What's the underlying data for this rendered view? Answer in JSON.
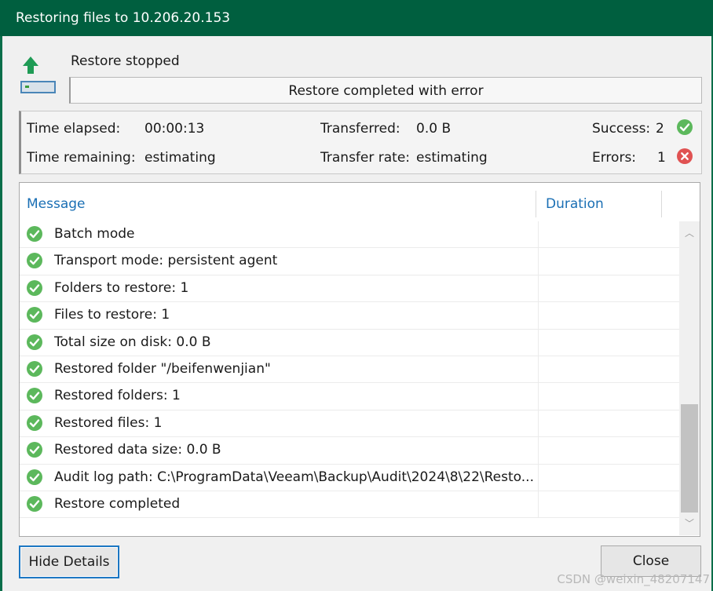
{
  "window": {
    "title": "Restoring files to 10.206.20.153"
  },
  "status": {
    "heading": "Restore stopped",
    "progress_text": "Restore completed with error",
    "progress_percent": 0
  },
  "stats": {
    "time_elapsed_label": "Time elapsed:",
    "time_elapsed_value": "00:00:13",
    "time_remaining_label": "Time remaining:",
    "time_remaining_value": "estimating",
    "transferred_label": "Transferred:",
    "transferred_value": "0.0 B",
    "transfer_rate_label": "Transfer rate:",
    "transfer_rate_value": "estimating",
    "success_label": "Success:",
    "success_value": "2",
    "errors_label": "Errors:",
    "errors_value": "1"
  },
  "messages": {
    "columns": {
      "message": "Message",
      "duration": "Duration"
    },
    "rows": [
      {
        "icon": "success-icon",
        "text": "Batch mode",
        "duration": ""
      },
      {
        "icon": "success-icon",
        "text": "Transport mode: persistent agent",
        "duration": ""
      },
      {
        "icon": "success-icon",
        "text": "Folders to restore: 1",
        "duration": ""
      },
      {
        "icon": "success-icon",
        "text": "Files to restore: 1",
        "duration": ""
      },
      {
        "icon": "success-icon",
        "text": "Total size on disk: 0.0 B",
        "duration": ""
      },
      {
        "icon": "success-icon",
        "text": "Restored folder \"/beifenwenjian\"",
        "duration": ""
      },
      {
        "icon": "success-icon",
        "text": "Restored folders: 1",
        "duration": ""
      },
      {
        "icon": "success-icon",
        "text": "Restored files: 1",
        "duration": ""
      },
      {
        "icon": "success-icon",
        "text": "Restored data size: 0.0 B",
        "duration": ""
      },
      {
        "icon": "success-icon",
        "text": "Audit log path: C:\\ProgramData\\Veeam\\Backup\\Audit\\2024\\8\\22\\Resto...",
        "duration": ""
      },
      {
        "icon": "success-icon",
        "text": "Restore completed",
        "duration": ""
      }
    ]
  },
  "buttons": {
    "hide_details": "Hide Details",
    "close": "Close"
  },
  "watermark": "CSDN @weixin_48207147",
  "colors": {
    "titlebar": "#005f3f",
    "success": "#5cb85c",
    "error": "#e05252",
    "link_header": "#1a6fb4",
    "focus_border": "#1c77c3"
  }
}
